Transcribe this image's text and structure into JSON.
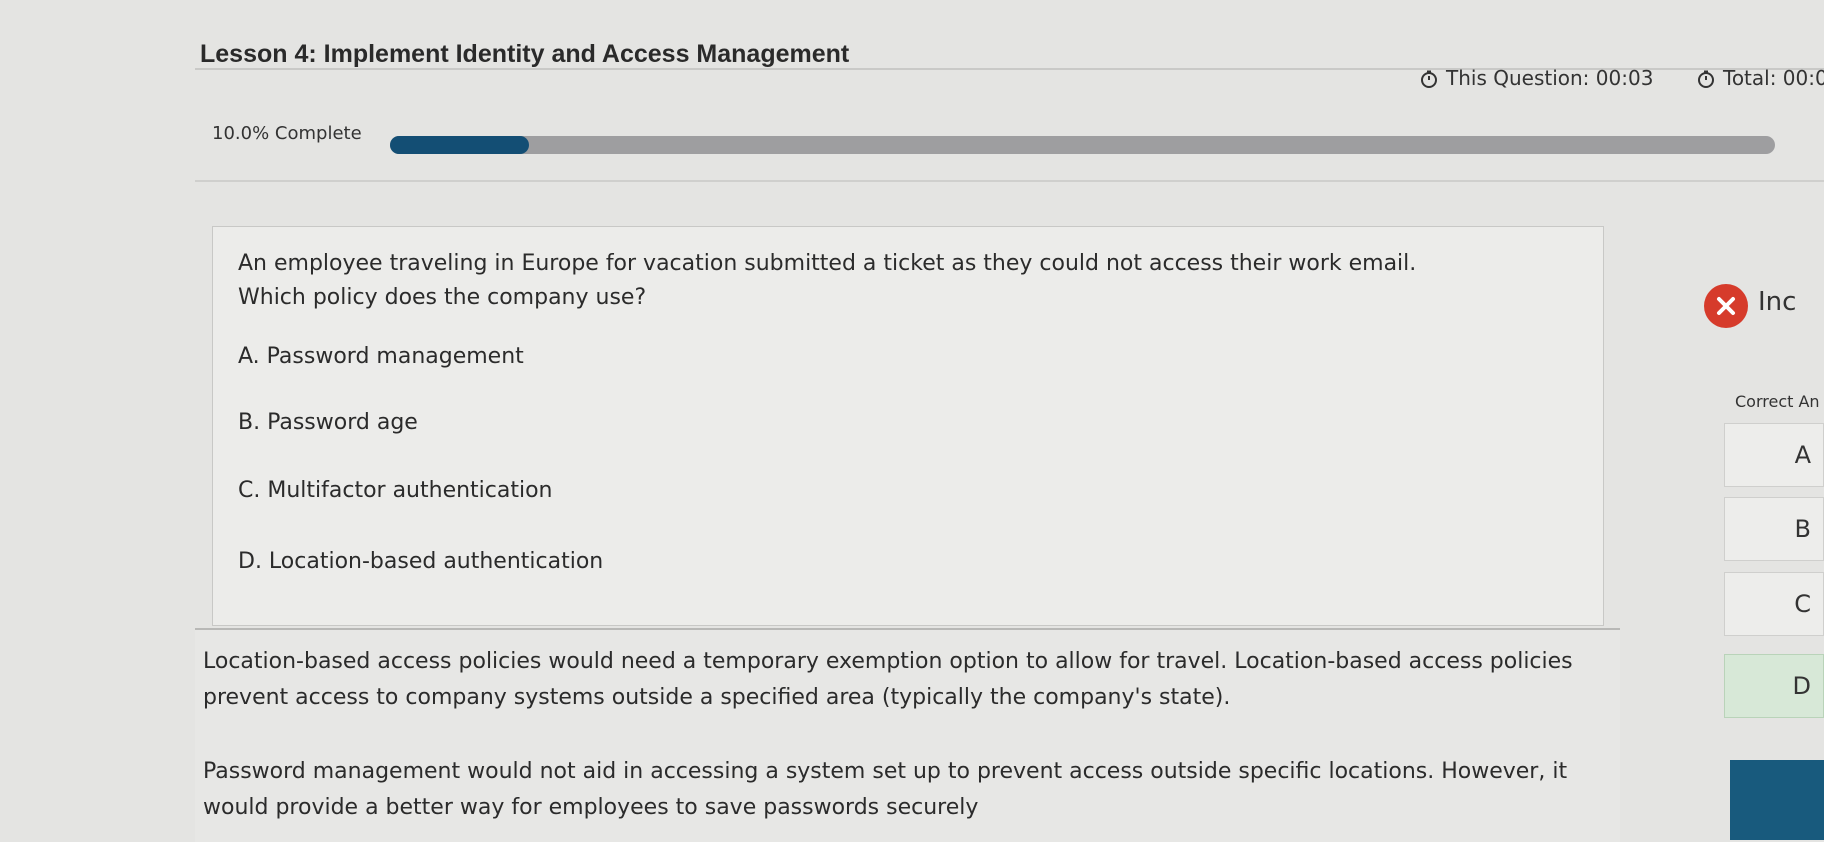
{
  "header": {
    "title": "Lesson 4: Implement Identity and Access Management",
    "question_timer": "This Question: 00:03",
    "total_timer": "Total: 00:0"
  },
  "progress": {
    "label": "10.0% Complete",
    "percent": 10.0
  },
  "question": {
    "stem_line1": "An employee traveling in Europe for vacation submitted a ticket as they could not access their work email.",
    "stem_line2": "Which policy does the company use?",
    "choices": [
      "A. Password management",
      "B. Password age",
      "C. Multifactor authentication",
      "D. Location-based authentication"
    ]
  },
  "explanation": {
    "para1": "Location-based access policies would need a temporary exemption option to allow for travel. Location-based access policies prevent access to company systems outside a specified area (typically the company's state).",
    "para2": "Password management would not aid in accessing a system set up to prevent access outside specific locations. However, it would provide a better way for employees to save passwords securely"
  },
  "result": {
    "status_text": "Inc",
    "correct_label": "Correct An",
    "answers": [
      "A",
      "B",
      "C",
      "D"
    ],
    "incorrect_color": "#d63b2b",
    "correct_highlight": "#d7e8d7"
  },
  "colors": {
    "progress_fill": "#134e74",
    "progress_track": "#9e9ea0",
    "accent_button": "#185a7d"
  },
  "icons": [
    "clock-icon",
    "close-icon"
  ]
}
